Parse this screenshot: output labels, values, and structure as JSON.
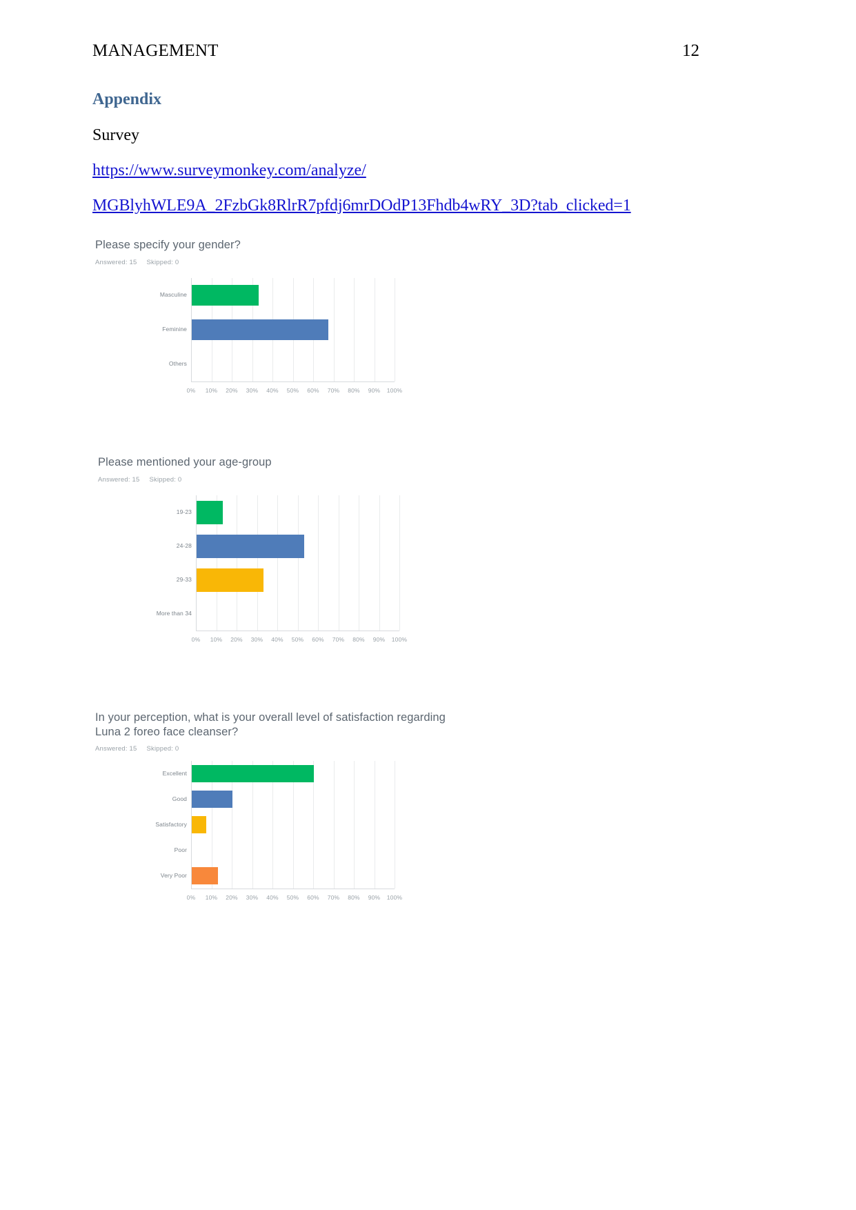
{
  "document": {
    "running_head": "MANAGEMENT",
    "page_number": "12",
    "appendix_heading": "Appendix",
    "survey_label": "Survey",
    "link_line_1": "https://www.surveymonkey.com/analyze/",
    "link_line_2": "MGBlyhWLE9A_2FzbGk8RlrR7pfdj6mrDOdP13Fhdb4wRY_3D?tab_clicked=1",
    "link_color": "#1414d0",
    "heading_color": "#3f6690"
  },
  "palette": {
    "green": "#00b862",
    "blue": "#4f7cb9",
    "amber": "#f9b706",
    "orange": "#f8883b",
    "grid": "#e9ebec",
    "axis": "#d7dadd",
    "title_text": "#5c6670",
    "meta_text": "#9aa2a8",
    "label_text": "#7c848b"
  },
  "charts": [
    {
      "id": "gender",
      "title": "Please specify your gender?",
      "answered_label": "Answered: 15",
      "skipped_label": "Skipped: 0",
      "chart_data": {
        "type": "bar",
        "orientation": "horizontal",
        "title": "Please specify your gender?",
        "xlabel": "",
        "ylabel": "",
        "xlim": [
          0,
          100
        ],
        "grid": true,
        "legend": "none",
        "categories": [
          "Masculine",
          "Feminine",
          "Others"
        ],
        "values": [
          33,
          67,
          0
        ],
        "colors": [
          "#00b862",
          "#4f7cb9",
          "#f9b706"
        ],
        "tick_labels": [
          "0%",
          "10%",
          "20%",
          "30%",
          "40%",
          "50%",
          "60%",
          "70%",
          "80%",
          "90%",
          "100%"
        ],
        "tick_values": [
          0,
          10,
          20,
          30,
          40,
          50,
          60,
          70,
          80,
          90,
          100
        ]
      }
    },
    {
      "id": "age-group",
      "title": "Please mentioned your age-group",
      "answered_label": "Answered: 15",
      "skipped_label": "Skipped: 0",
      "chart_data": {
        "type": "bar",
        "orientation": "horizontal",
        "title": "Please mentioned your age-group",
        "xlabel": "",
        "ylabel": "",
        "xlim": [
          0,
          100
        ],
        "grid": true,
        "legend": "none",
        "categories": [
          "19-23",
          "24-28",
          "29-33",
          "More than 34"
        ],
        "values": [
          13,
          53,
          33,
          0
        ],
        "colors": [
          "#00b862",
          "#4f7cb9",
          "#f9b706",
          "#f8883b"
        ],
        "tick_labels": [
          "0%",
          "10%",
          "20%",
          "30%",
          "40%",
          "50%",
          "60%",
          "70%",
          "80%",
          "90%",
          "100%"
        ],
        "tick_values": [
          0,
          10,
          20,
          30,
          40,
          50,
          60,
          70,
          80,
          90,
          100
        ]
      }
    },
    {
      "id": "satisfaction",
      "title": "In your perception, what is your overall level of satisfaction regarding Luna 2 foreo face cleanser?",
      "answered_label": "Answered: 15",
      "skipped_label": "Skipped: 0",
      "chart_data": {
        "type": "bar",
        "orientation": "horizontal",
        "title": "In your perception, what is your overall level of satisfaction regarding Luna 2 foreo face cleanser?",
        "xlabel": "",
        "ylabel": "",
        "xlim": [
          0,
          100
        ],
        "grid": true,
        "legend": "none",
        "categories": [
          "Excellent",
          "Good",
          "Satisfactory",
          "Poor",
          "Very Poor"
        ],
        "values": [
          60,
          20,
          7,
          0,
          13
        ],
        "colors": [
          "#00b862",
          "#4f7cb9",
          "#f9b706",
          "#ef5350",
          "#f8883b"
        ],
        "tick_labels": [
          "0%",
          "10%",
          "20%",
          "30%",
          "40%",
          "50%",
          "60%",
          "70%",
          "80%",
          "90%",
          "100%"
        ],
        "tick_values": [
          0,
          10,
          20,
          30,
          40,
          50,
          60,
          70,
          80,
          90,
          100
        ]
      }
    }
  ]
}
